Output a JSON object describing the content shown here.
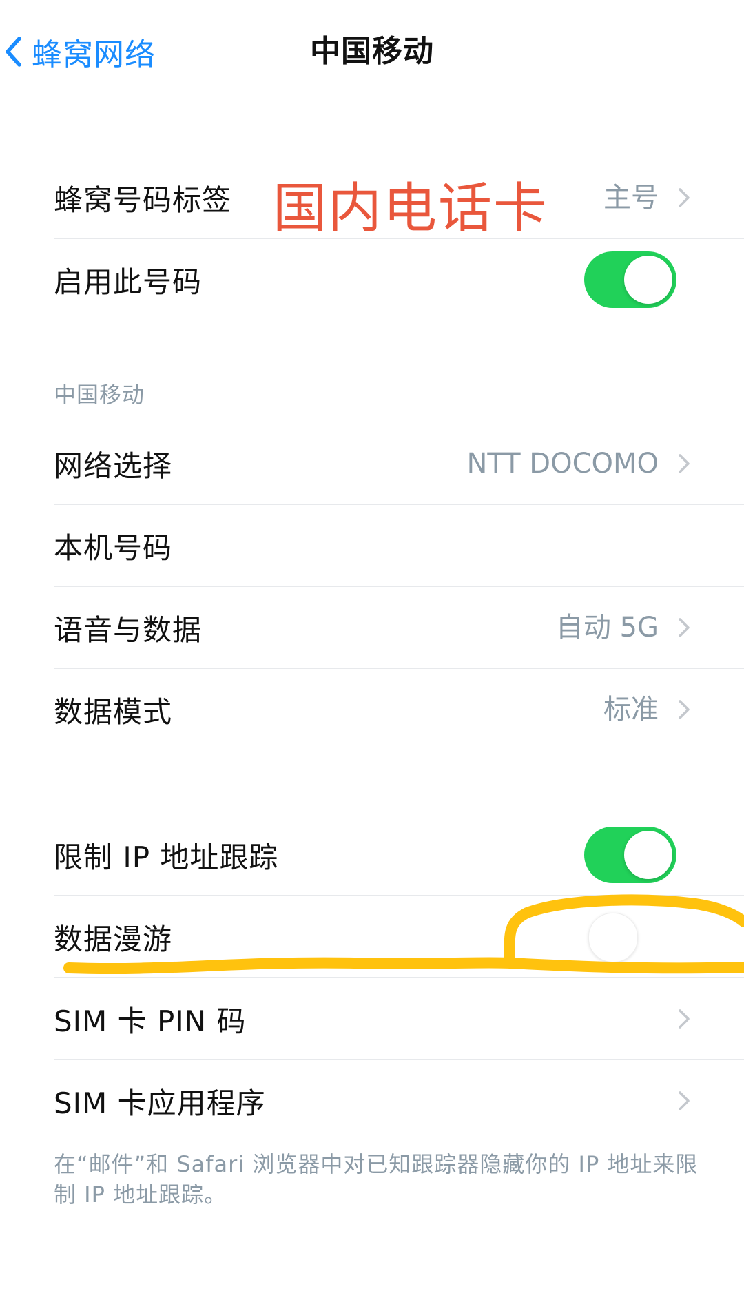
{
  "nav": {
    "back_label": "蜂窝网络",
    "title": "中国移动"
  },
  "group1": {
    "label_row": {
      "label": "蜂窝号码标签",
      "value": "主号"
    },
    "enable_row": {
      "label": "启用此号码",
      "toggle_on": true
    }
  },
  "annotation": {
    "text": "国内电话卡",
    "color": "#e9573c",
    "scribble_color": "#ffc20e"
  },
  "section": {
    "header": "中国移动",
    "rows": [
      {
        "label": "网络选择",
        "value": "NTT DOCOMO"
      },
      {
        "label": "本机号码",
        "value": ""
      },
      {
        "label": "语音与数据",
        "value": "自动 5G"
      },
      {
        "label": "数据模式",
        "value": "标准"
      }
    ]
  },
  "group3": {
    "ip_row": {
      "label": "限制 IP 地址跟踪",
      "toggle_on": true
    },
    "roaming_row": {
      "label": "数据漫游",
      "toggle_on": false
    },
    "sim_pin_row": {
      "label": "SIM 卡 PIN 码"
    },
    "sim_app_row": {
      "label": "SIM 卡应用程序"
    }
  },
  "footer": {
    "text": "在“邮件”和 Safari 浏览器中对已知跟踪器隐藏你的 IP 地址来限制 IP 地址跟踪。"
  },
  "colors": {
    "accent": "#1a8cff",
    "toggle_on": "#21d159",
    "secondary_text": "#8b9aa6"
  },
  "icons": {
    "back": "chevron-left-icon",
    "disclosure": "chevron-right-icon"
  }
}
